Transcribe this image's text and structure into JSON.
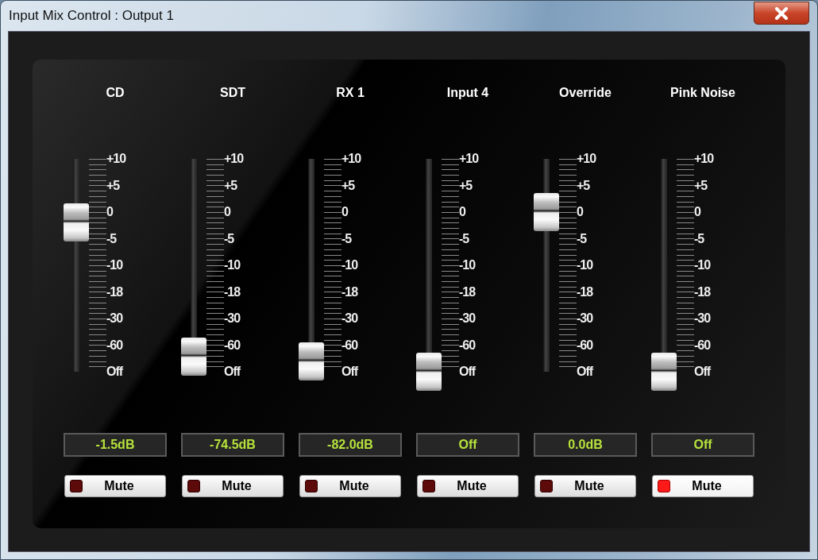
{
  "window": {
    "title": "Input Mix Control : Output 1"
  },
  "channels": [
    {
      "name": "CD",
      "level": 0.7,
      "scale": [
        "+10",
        "+5",
        "0",
        "-5",
        "-10",
        "-18",
        "-30",
        "-60",
        "Off"
      ],
      "reading": "-1.5dB",
      "mute": {
        "label": "Mute",
        "muted": false
      }
    },
    {
      "name": "SDT",
      "level": 0.07,
      "scale": [
        "+10",
        "+5",
        "0",
        "-5",
        "-10",
        "-18",
        "-30",
        "-60",
        "Off"
      ],
      "reading": "-74.5dB",
      "mute": {
        "label": "Mute",
        "muted": false
      }
    },
    {
      "name": "RX 1",
      "level": 0.05,
      "scale": [
        "+10",
        "+5",
        "0",
        "-5",
        "-10",
        "-18",
        "-30",
        "-60",
        "Off"
      ],
      "reading": "-82.0dB",
      "mute": {
        "label": "Mute",
        "muted": false
      }
    },
    {
      "name": "Input 4",
      "level": 0,
      "scale": [
        "+10",
        "+5",
        "0",
        "-5",
        "-10",
        "-18",
        "-30",
        "-60",
        "Off"
      ],
      "reading": "Off",
      "mute": {
        "label": "Mute",
        "muted": false
      }
    },
    {
      "name": "Override",
      "level": 0.75,
      "scale": [
        "+10",
        "+5",
        "0",
        "-5",
        "-10",
        "-18",
        "-30",
        "-60",
        "Off"
      ],
      "reading": "0.0dB",
      "mute": {
        "label": "Mute",
        "muted": false
      }
    },
    {
      "name": "Pink Noise",
      "level": 0,
      "scale": [
        "+10",
        "+5",
        "0",
        "-5",
        "-10",
        "-18",
        "-30",
        "-60",
        "Off"
      ],
      "reading": "Off",
      "mute": {
        "label": "Mute",
        "muted": true
      }
    }
  ]
}
